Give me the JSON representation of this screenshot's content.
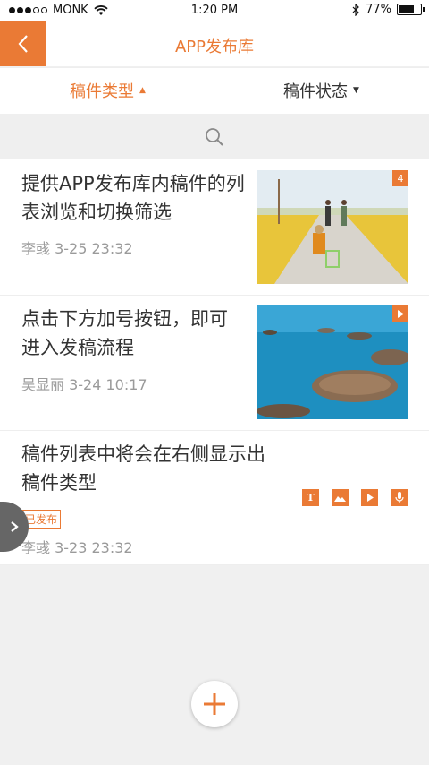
{
  "status_bar": {
    "carrier": "MONK",
    "time": "1:20 PM",
    "battery": "77%",
    "battery_level": 0.77
  },
  "navbar": {
    "title": "APP发布库"
  },
  "filters": {
    "tab1_label": "稿件类型",
    "tab2_label": "稿件状态"
  },
  "items": [
    {
      "title": "提供APP发布库内稿件的列表浏览和切换筛选",
      "meta": "李彧 3-25 23:32",
      "badge": "4"
    },
    {
      "title": "点击下方加号按钮，即可进入发稿流程",
      "meta": "吴显丽 3-24 10:17"
    },
    {
      "title": "稿件列表中将会在右侧显示出稿件类型",
      "status": "已发布",
      "meta": "李彧 3-23 23:32",
      "type_icons": [
        "text-icon",
        "image-icon",
        "video-icon",
        "audio-icon"
      ]
    }
  ],
  "colors": {
    "accent": "#ea7a35"
  }
}
